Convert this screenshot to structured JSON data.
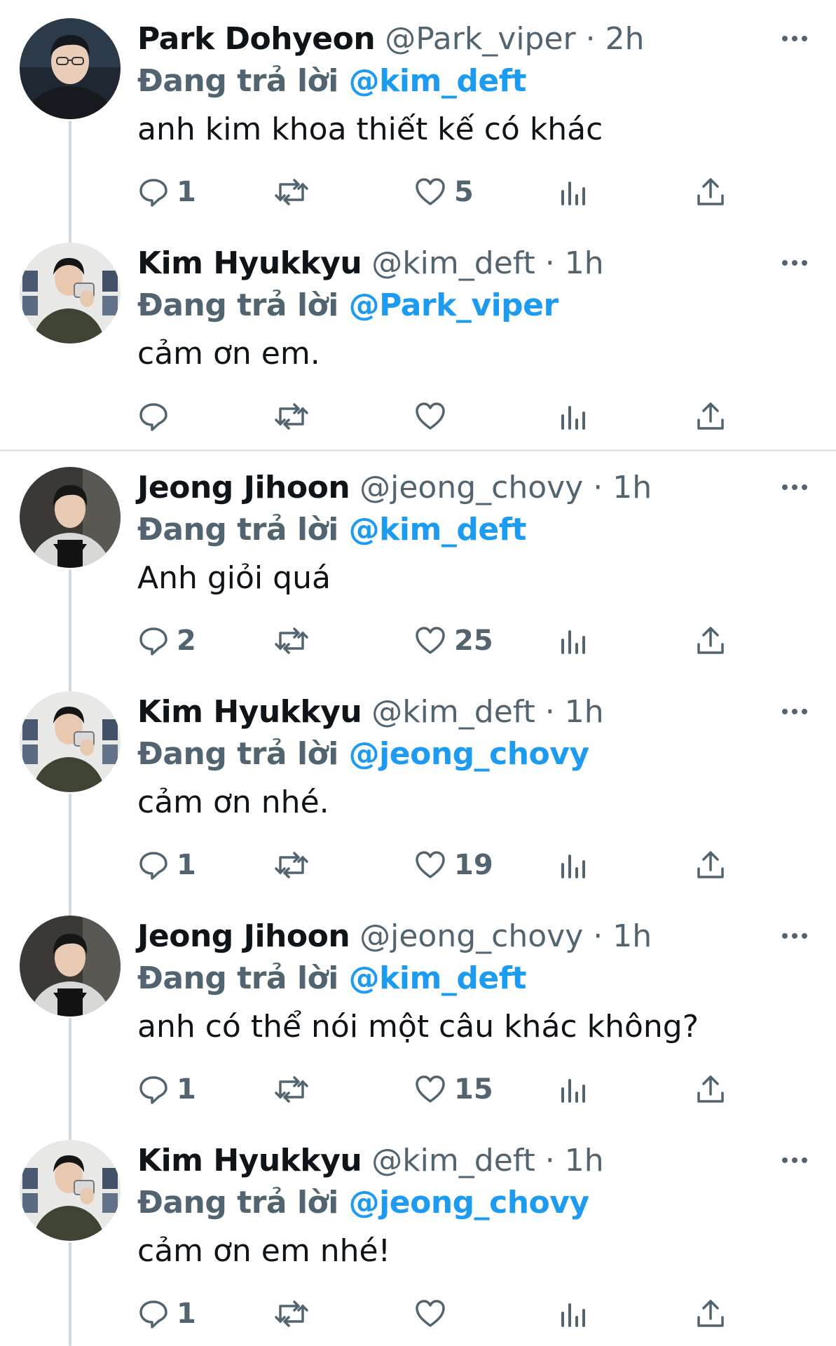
{
  "reply_prefix": "Đang trả lời",
  "tweets": [
    {
      "name": "Park Dohyeon",
      "handle": "@Park_viper",
      "separator": "·",
      "time": "2h",
      "reply_to": "@kim_deft",
      "text": "anh kim khoa thiết kế có khác",
      "replies": "1",
      "retweets": "",
      "likes": "5",
      "avatar": "park-avatar"
    },
    {
      "name": "Kim Hyukkyu",
      "handle": "@kim_deft",
      "separator": "·",
      "time": "1h",
      "reply_to": "@Park_viper",
      "text": "cảm ơn em.",
      "replies": "",
      "retweets": "",
      "likes": "",
      "avatar": "kim-avatar"
    },
    {
      "name": "Jeong Jihoon",
      "handle": "@jeong_chovy",
      "separator": "·",
      "time": "1h",
      "reply_to": "@kim_deft",
      "text": "Anh giỏi quá",
      "replies": "2",
      "retweets": "",
      "likes": "25",
      "avatar": "jeong-avatar"
    },
    {
      "name": "Kim Hyukkyu",
      "handle": "@kim_deft",
      "separator": "·",
      "time": "1h",
      "reply_to": "@jeong_chovy",
      "text": "cảm ơn nhé.",
      "replies": "1",
      "retweets": "",
      "likes": "19",
      "avatar": "kim-avatar"
    },
    {
      "name": "Jeong Jihoon",
      "handle": "@jeong_chovy",
      "separator": "·",
      "time": "1h",
      "reply_to": "@kim_deft",
      "text": "anh có thể nói một câu khác không?",
      "replies": "1",
      "retweets": "",
      "likes": "15",
      "avatar": "jeong-avatar"
    },
    {
      "name": "Kim Hyukkyu",
      "handle": "@kim_deft",
      "separator": "·",
      "time": "1h",
      "reply_to": "@jeong_chovy",
      "text": "cảm ơn em nhé!",
      "replies": "1",
      "retweets": "",
      "likes": "",
      "avatar": "kim-avatar"
    }
  ],
  "colors": {
    "accent": "#1d9bf0",
    "secondary_text": "#536471",
    "primary_text": "#0f1419",
    "thread_line": "#cfd9de"
  },
  "icons": {
    "reply": "speech-bubble-icon",
    "retweet": "retweet-icon",
    "like": "heart-icon",
    "views": "bar-chart-icon",
    "share": "share-upload-icon",
    "more": "more-dots-icon"
  }
}
